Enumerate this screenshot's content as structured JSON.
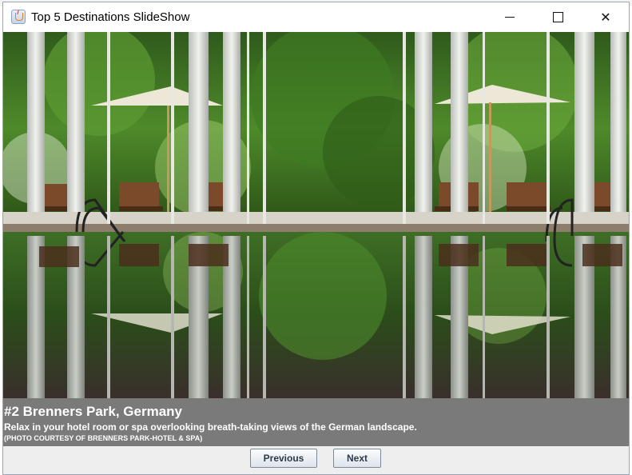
{
  "window": {
    "title": "Top 5 Destinations SlideShow",
    "icon": "java-coffee-cup-icon",
    "controls": [
      "minimize-icon",
      "maximize-icon",
      "close-icon"
    ],
    "close_symbol": "✕"
  },
  "slide": {
    "title": "#2 Brenners Park, Germany",
    "description": "Relax in your hotel room or spa overlooking breath-taking views of the German landscape.",
    "credit": "(PHOTO COURTESY OF BRENNERS PARK-HOTEL & SPA)"
  },
  "navigation": {
    "previous_label": "Previous",
    "next_label": "Next"
  },
  "colors": {
    "caption_background": "#7a7a7a",
    "caption_text": "#ffffff",
    "button_text": "#2b3a4a"
  }
}
